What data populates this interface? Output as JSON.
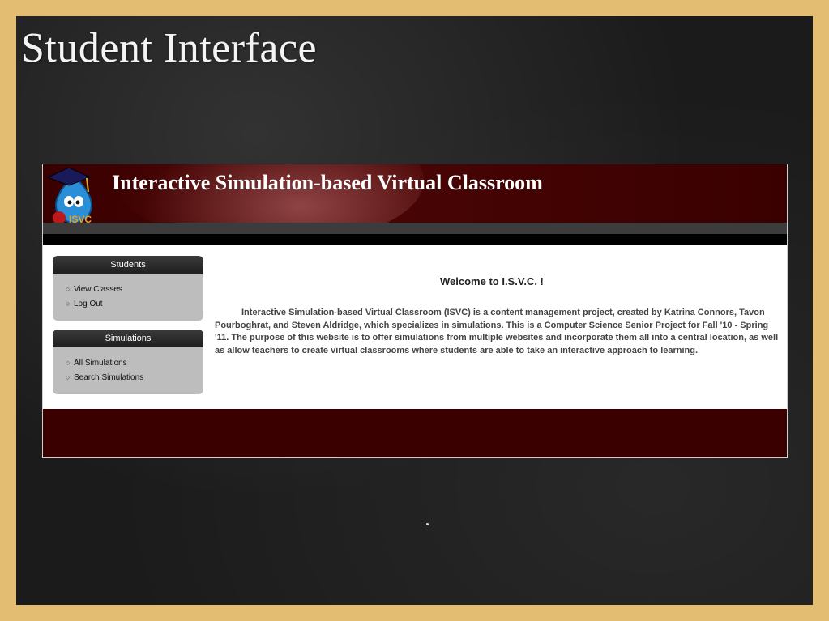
{
  "slide": {
    "title": "Student Interface"
  },
  "site": {
    "title": "Interactive Simulation-based Virtual Classroom",
    "logo_text": "ISVC"
  },
  "sidebar": {
    "students": {
      "heading": "Students",
      "items": [
        {
          "label": "View Classes"
        },
        {
          "label": "Log Out"
        }
      ]
    },
    "simulations": {
      "heading": "Simulations",
      "items": [
        {
          "label": "All Simulations"
        },
        {
          "label": "Search Simulations"
        }
      ]
    }
  },
  "main": {
    "welcome": "Welcome to I.S.V.C. !",
    "intro": "Interactive Simulation-based Virtual Classroom (ISVC) is a content management project, created by Katrina Connors, Tavon Pourboghrat, and Steven Aldridge, which specializes in simulations. This is a Computer Science Senior Project for Fall '10 - Spring '11. The purpose of this website is to offer simulations from multiple websites and incorporate them all into a central location, as well as allow teachers to create virtual classrooms where students are able to take an interactive approach to learning."
  },
  "colors": {
    "banner": "#3a0000",
    "sidebar_box": "#bdbdbd",
    "frame": "#e3be72",
    "chalkboard": "#1b1b1b"
  },
  "icons": {
    "bullet": "circle-bullet-icon",
    "logo": "graduation-drop-logo"
  }
}
